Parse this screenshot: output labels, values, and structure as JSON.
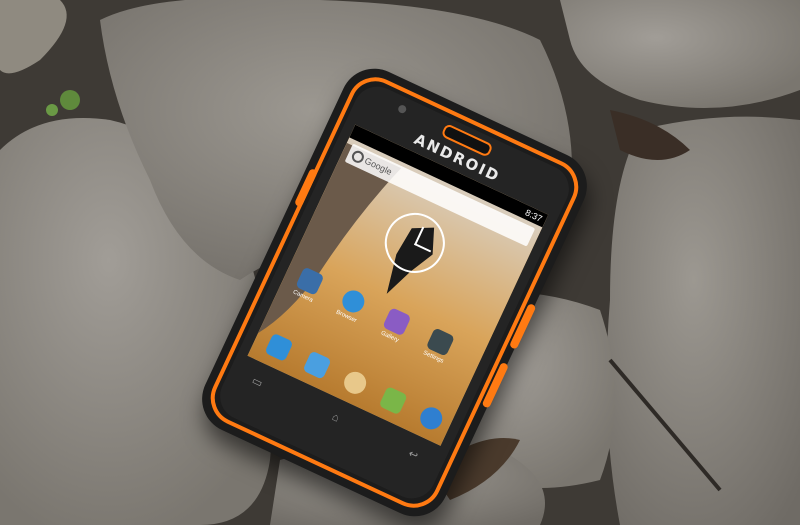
{
  "phone": {
    "brand_label": "ANDROID",
    "status_time": "8:37",
    "search_placeholder": "Google",
    "icon_labels": [
      "Camera",
      "Browser",
      "Gallery",
      "Settings"
    ]
  },
  "colors": {
    "accent_orange": "#ff7a12",
    "phone_body": "#1c1c1c",
    "rock": "#8b8780"
  }
}
